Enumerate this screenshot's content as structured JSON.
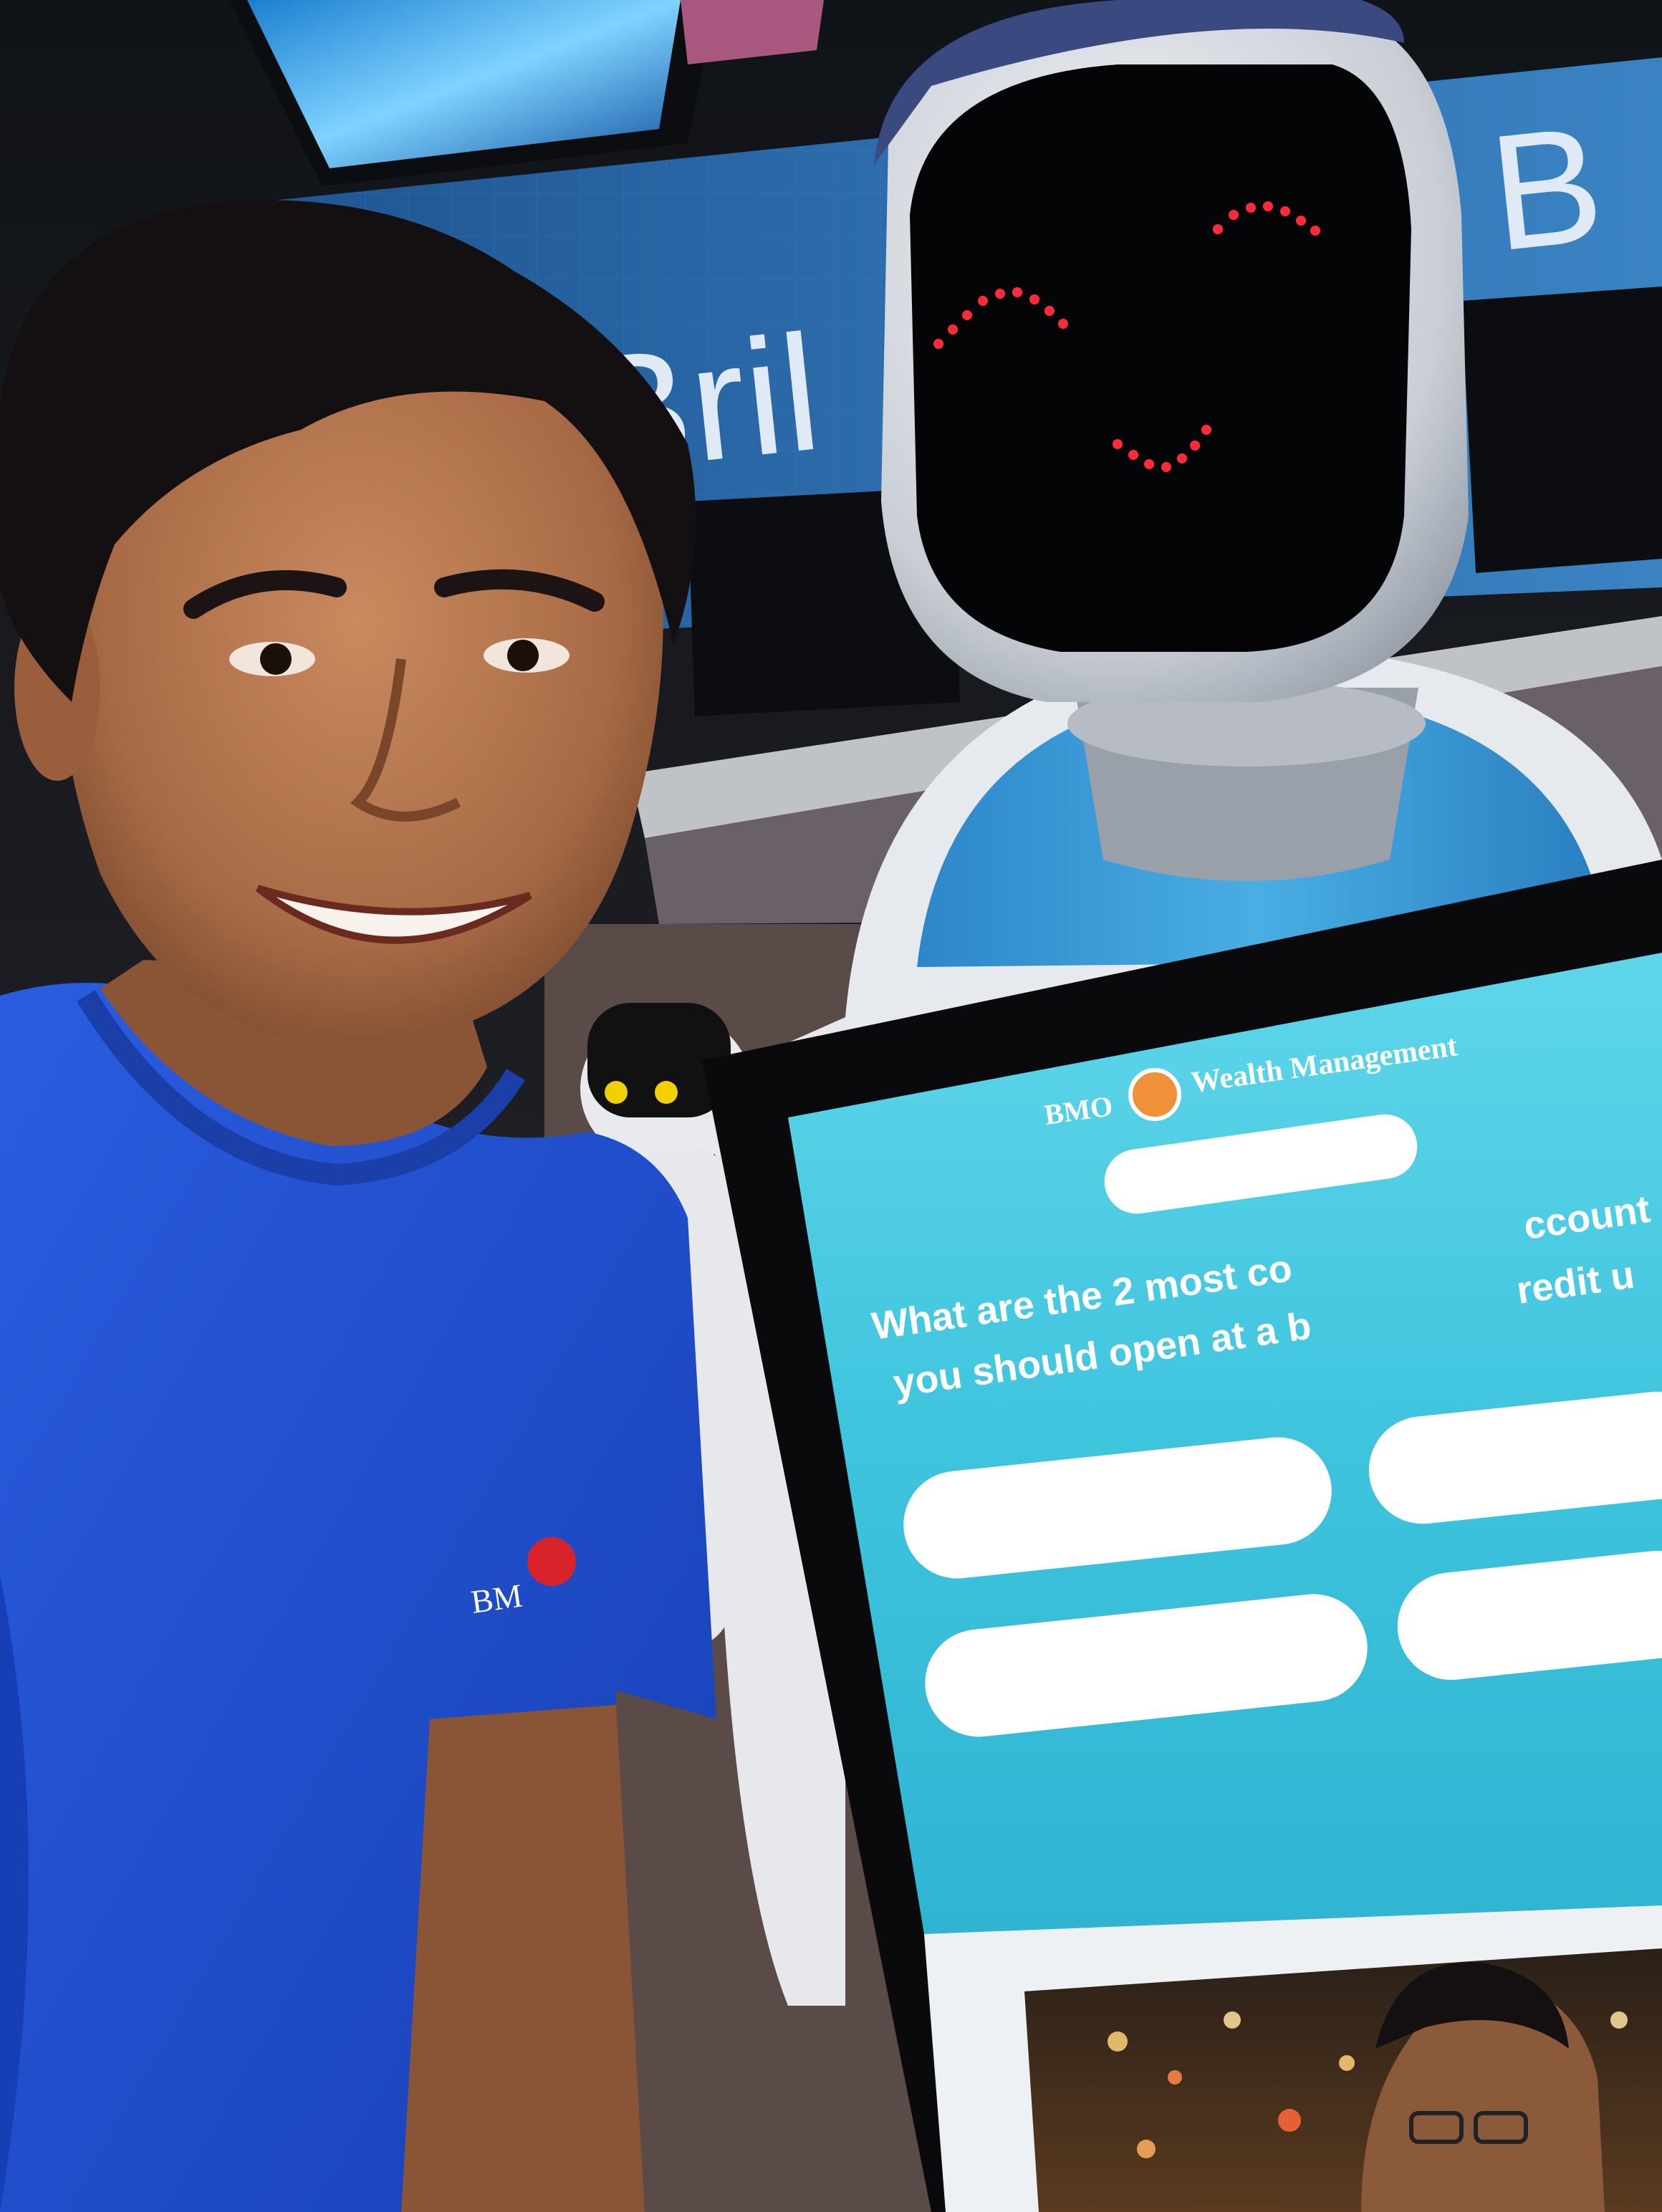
{
  "background_sign": {
    "partial_text_left": "Bril",
    "partial_text_right": "e B"
  },
  "shirt_logo": {
    "text": "BM"
  },
  "kiosk": {
    "brand_name": "BMO",
    "brand_subtitle": "Wealth Management",
    "question_line_1": "What are the 2 most co",
    "question_line_1_tail": "ccount",
    "question_line_1_end": "redit u",
    "question_line_2": "you should open at a b",
    "answer_options_count": 4
  },
  "colors": {
    "shirt_blue": "#1f4fd6",
    "kiosk_cyan": "#3fc7de",
    "sign_blue": "#2b6aa8",
    "robot_blue": "#3b9fd6",
    "robot_face_led": "#ff2a3a"
  }
}
